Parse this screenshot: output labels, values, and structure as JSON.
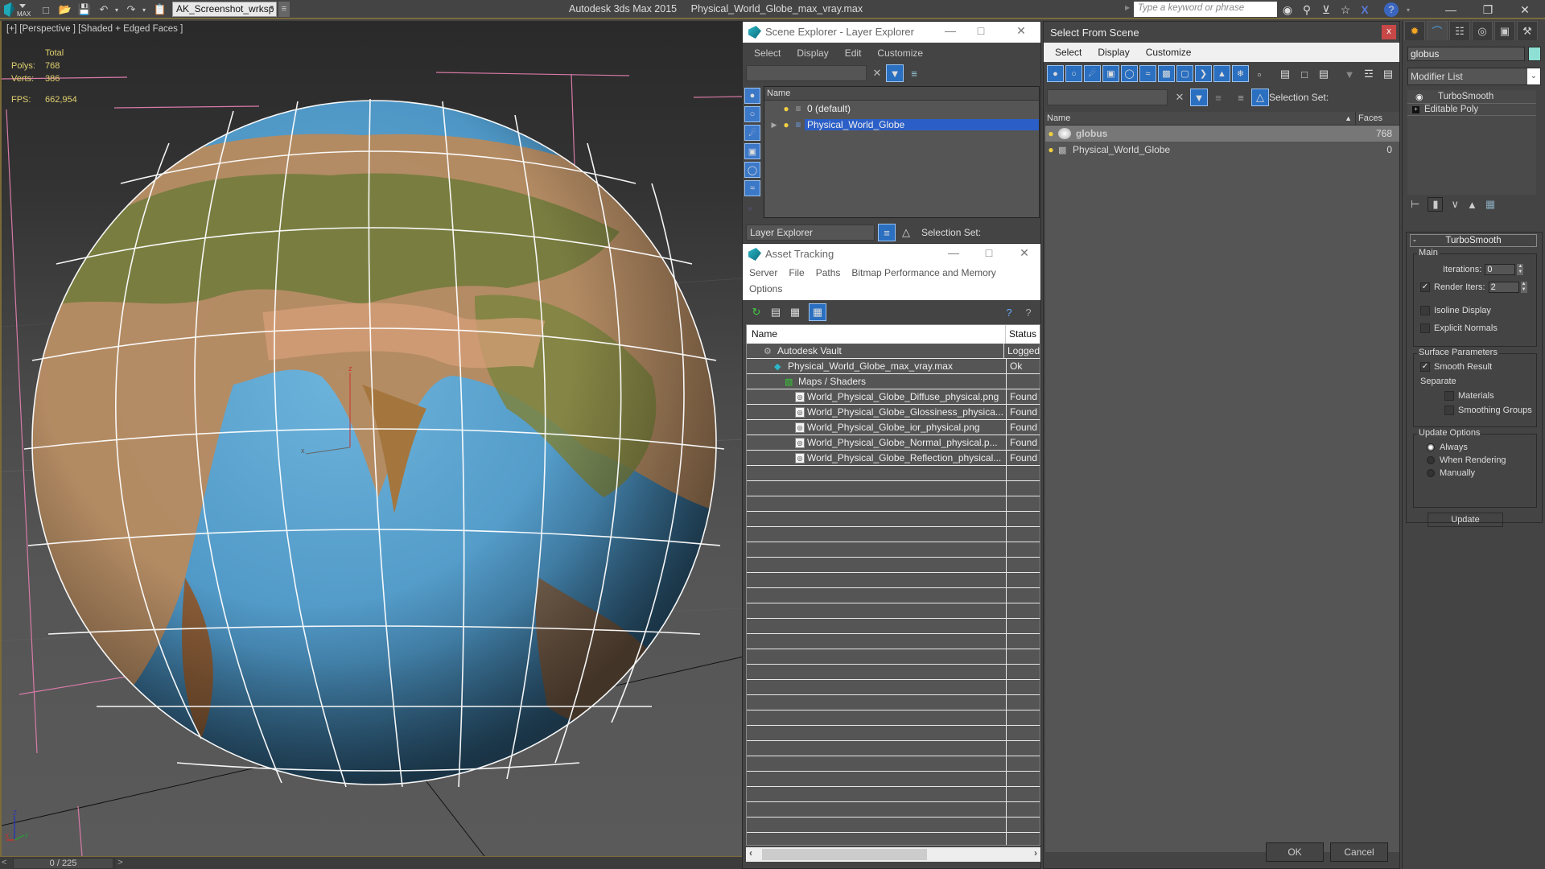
{
  "app": {
    "title_app": "Autodesk 3ds Max  2015",
    "title_file": "Physical_World_Globe_max_vray.max",
    "workspace": "AK_Screenshot_wrksp",
    "search_placeholder": "Type a keyword or phrase",
    "quick_access_icons": [
      "new-file-icon",
      "open-file-icon",
      "save-icon",
      "undo-icon",
      "redo-icon",
      "project-folder-icon"
    ],
    "toolbar_icons": [
      "binoculars-icon",
      "key-icon",
      "satellite-icon",
      "star-icon",
      "x-icon",
      "help-icon"
    ]
  },
  "viewport": {
    "label": "[+] [Perspective ] [Shaded + Edged Faces ]",
    "stats": {
      "header": "Total",
      "polys_label": "Polys:",
      "polys": "768",
      "verts_label": "Verts:",
      "verts": "386",
      "fps_label": "FPS:",
      "fps": "662,954"
    },
    "time_slider": "0 / 225",
    "prev": "<",
    "next": ">",
    "gizmo": {
      "x": "X",
      "y": "y",
      "z": "Z"
    }
  },
  "scene_explorer": {
    "title": "Scene Explorer - Layer Explorer",
    "menu": [
      "Select",
      "Display",
      "Edit",
      "Customize"
    ],
    "column": "Name",
    "rows": [
      {
        "name": "0 (default)",
        "selected": false
      },
      {
        "name": "Physical_World_Globe",
        "selected": true
      }
    ],
    "explorer_type": "Layer Explorer",
    "selection_set_label": "Selection Set:"
  },
  "asset_tracking": {
    "title": "Asset Tracking",
    "menu_line1": [
      "Server",
      "File",
      "Paths",
      "Bitmap Performance and Memory"
    ],
    "menu_line2": [
      "Options"
    ],
    "columns": [
      "Name",
      "Status"
    ],
    "rows": [
      {
        "name": "Autodesk Vault",
        "status": "Logged",
        "level": 1,
        "icon": "vault-icon"
      },
      {
        "name": "Physical_World_Globe_max_vray.max",
        "status": "Ok",
        "level": 2,
        "icon": "max-file-icon"
      },
      {
        "name": "Maps / Shaders",
        "status": "",
        "level": 3,
        "icon": "maps-icon"
      },
      {
        "name": "World_Physical_Globe_Diffuse_physical.png",
        "status": "Found",
        "level": 4,
        "icon": "image-file-icon"
      },
      {
        "name": "World_Physical_Globe_Glossiness_physica...",
        "status": "Found",
        "level": 4,
        "icon": "image-file-icon"
      },
      {
        "name": "World_Physical_Globe_ior_physical.png",
        "status": "Found",
        "level": 4,
        "icon": "image-file-icon"
      },
      {
        "name": "World_Physical_Globe_Normal_physical.p...",
        "status": "Found",
        "level": 4,
        "icon": "image-file-icon"
      },
      {
        "name": "World_Physical_Globe_Reflection_physical...",
        "status": "Found",
        "level": 4,
        "icon": "image-file-icon"
      }
    ],
    "empty_rows": 25
  },
  "select_from_scene": {
    "title": "Select From Scene",
    "close": "x",
    "menu": [
      "Select",
      "Display",
      "Customize"
    ],
    "selection_set_label": "Selection Set:",
    "columns": [
      "Name",
      "Faces"
    ],
    "rows": [
      {
        "name": "globus",
        "faces": "768",
        "selected": true
      },
      {
        "name": "Physical_World_Globe",
        "faces": "0",
        "selected": false
      }
    ],
    "ok": "OK",
    "cancel": "Cancel"
  },
  "command_panel": {
    "object_name": "globus",
    "object_color": "#8fe0d4",
    "modifier_list": "Modifier List",
    "stack": [
      "TurboSmooth",
      "Editable Poly"
    ],
    "rollout_title": "TurboSmooth",
    "main_group": "Main",
    "iterations_label": "Iterations:",
    "iterations": "0",
    "render_iters_label": "Render Iters:",
    "render_iters": "2",
    "render_iters_checked": true,
    "isoline_label": "Isoline Display",
    "isoline_checked": false,
    "explicit_normals_label": "Explicit Normals",
    "explicit_normals_checked": false,
    "surface_group": "Surface Parameters",
    "smooth_result_label": "Smooth Result",
    "smooth_result_checked": true,
    "separate_label": "Separate",
    "materials_label": "Materials",
    "materials_checked": false,
    "smoothing_groups_label": "Smoothing Groups",
    "smoothing_groups_checked": false,
    "update_group": "Update Options",
    "update_options": [
      "Always",
      "When Rendering",
      "Manually"
    ],
    "update_selected": "Always",
    "update_button": "Update"
  },
  "colors": {
    "accent_selection": "#2b5fc7",
    "viewport_border": "#7b6a3a",
    "stats_text": "#e0d070"
  }
}
